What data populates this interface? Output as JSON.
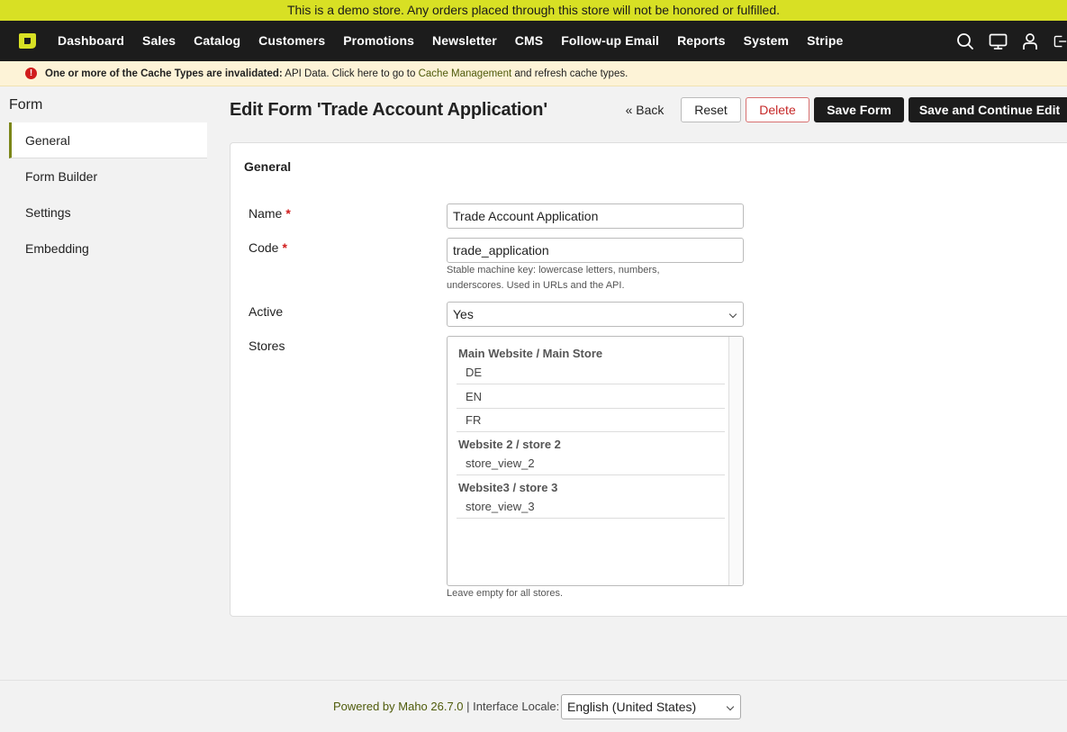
{
  "demo_notice": "This is a demo store. Any orders placed through this store will not be honored or fulfilled.",
  "nav": {
    "items": [
      "Dashboard",
      "Sales",
      "Catalog",
      "Customers",
      "Promotions",
      "Newsletter",
      "CMS",
      "Follow-up Email",
      "Reports",
      "System",
      "Stripe"
    ],
    "active": "CMS",
    "icons": [
      "search-icon",
      "monitor-icon",
      "user-icon",
      "logout-icon"
    ]
  },
  "cache_notice": {
    "bold": "One or more of the Cache Types are invalidated:",
    "text": " API Data. Click here to go to ",
    "link": "Cache Management",
    "tail": " and refresh cache types."
  },
  "sidebar": {
    "title": "Form",
    "tabs": [
      "General",
      "Form Builder",
      "Settings",
      "Embedding"
    ],
    "active": "General"
  },
  "page_title": "Edit Form 'Trade Account Application'",
  "actions": {
    "back": "« Back",
    "reset": "Reset",
    "delete": "Delete",
    "save": "Save Form",
    "save_continue": "Save and Continue Edit"
  },
  "section_title": "General",
  "fields": {
    "name": {
      "label": "Name",
      "required": "*",
      "value": "Trade Account Application"
    },
    "code": {
      "label": "Code",
      "required": "*",
      "value": "trade_application",
      "hint_line1": "Stable machine key: lowercase letters, numbers,",
      "hint_line2": "underscores. Used in URLs and the API."
    },
    "active": {
      "label": "Active",
      "value": "Yes"
    },
    "stores": {
      "label": "Stores",
      "groups": [
        {
          "name": "Main Website / Main Store",
          "options": [
            "DE",
            "EN",
            "FR"
          ]
        },
        {
          "name": "Website 2 / store 2",
          "options": [
            "store_view_2"
          ]
        },
        {
          "name": "Website3 / store 3",
          "options": [
            "store_view_3"
          ]
        }
      ],
      "hint": "Leave empty for all stores."
    }
  },
  "footer": {
    "powered": "Powered by Maho 26.7.0",
    "separator": " | ",
    "locale_label": "Interface Locale:",
    "locale_value": "English (United States)"
  },
  "colors": {
    "demo_bar": "#d8e024",
    "nav_bg": "#1c1c1c",
    "accent": "#7b8618",
    "danger": "#c62828"
  }
}
